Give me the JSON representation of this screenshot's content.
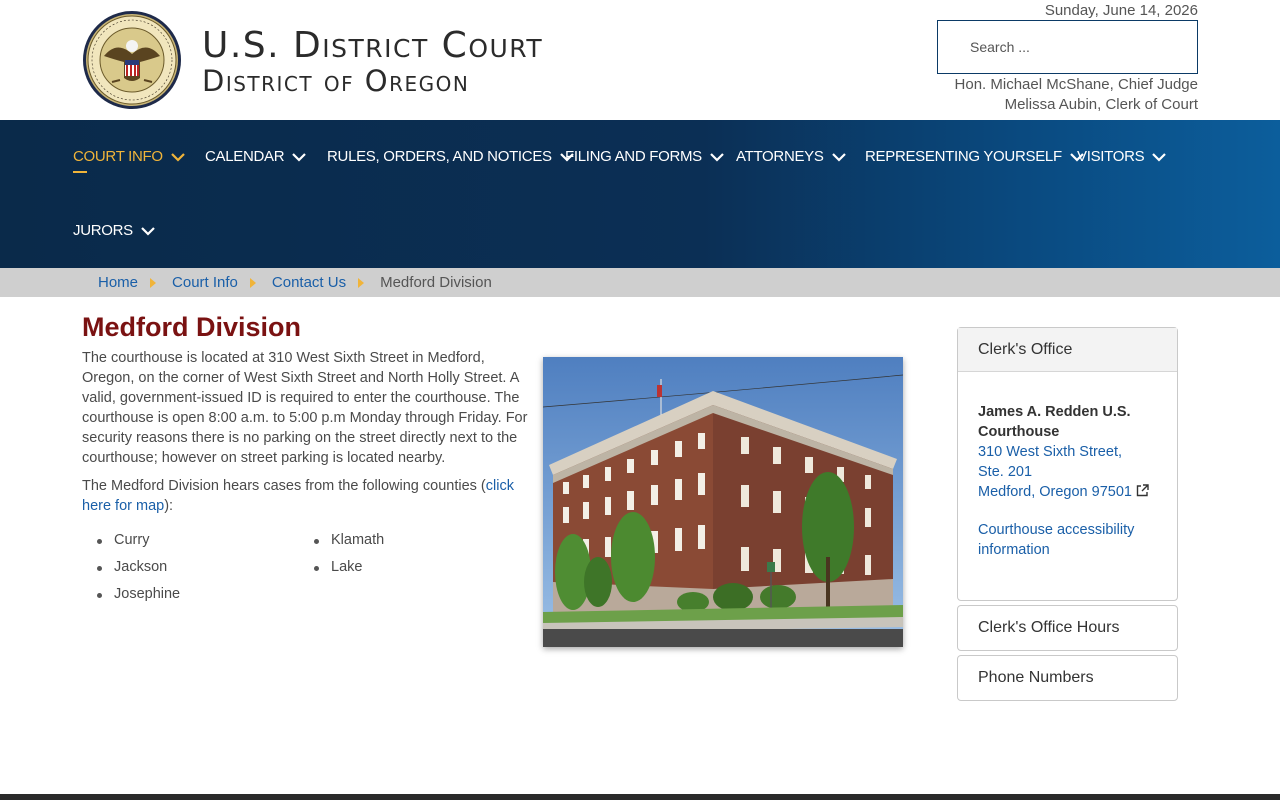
{
  "header": {
    "title_line1": "U.S. District Court",
    "title_line2": "District of Oregon",
    "seal_text": "UNITED STATES DISTRICT COURT · DISTRICT OF OREGON",
    "date": "Sunday, June 14, 2026",
    "search_placeholder": "Search ...",
    "chief_judge": "Hon. Michael McShane, Chief Judge",
    "clerk": "Melissa Aubin, Clerk of Court"
  },
  "nav": {
    "items": [
      {
        "label": "COURT INFO",
        "active": true
      },
      {
        "label": "CALENDAR"
      },
      {
        "label": "RULES, ORDERS, AND NOTICES"
      },
      {
        "label": "FILING AND FORMS"
      },
      {
        "label": "ATTORNEYS"
      },
      {
        "label": "REPRESENTING YOURSELF"
      },
      {
        "label": "VISITORS"
      },
      {
        "label": "JURORS"
      }
    ],
    "active_color": "#f0b43a"
  },
  "breadcrumb": {
    "items": [
      "Home",
      "Court Info",
      "Contact Us"
    ],
    "current": "Medford Division"
  },
  "main": {
    "title": "Medford Division",
    "intro": "The courthouse is located at 310 West Sixth Street in Medford, Oregon, on the corner of West Sixth Street and North Holly Street. A valid, government-issued ID is required to enter the courthouse. The courthouse is open 8:00 a.m. to 5:00 p.m Monday through Friday. For security reasons there is no parking on the street directly next to the courthouse; however on street parking is located nearby.",
    "counties_intro": "The Medford Division hears cases from the following counties (",
    "map_link": "click here for map",
    "counties_intro_end": "):",
    "counties_col1": [
      "Curry",
      "Jackson",
      "Josephine"
    ],
    "counties_col2": [
      "Klamath",
      "Lake"
    ],
    "photo_alt": "James A. Redden U.S. Courthouse building"
  },
  "sidebar": {
    "clerks_office": {
      "title": "Clerk's Office",
      "building": "James A. Redden U.S. Courthouse",
      "address_line1": "310 West Sixth Street,",
      "address_line2": "Ste. 201",
      "address_line3": "Medford, Oregon 97501",
      "accessibility_link": "Courthouse accessibility information"
    },
    "hours_title": "Clerk's Office Hours",
    "phone_title": "Phone Numbers"
  },
  "colors": {
    "title_red": "#7a1212",
    "link_blue": "#1a5fa8",
    "nav_dark": "#0a2a4a",
    "accent_gold": "#f0b43a"
  }
}
